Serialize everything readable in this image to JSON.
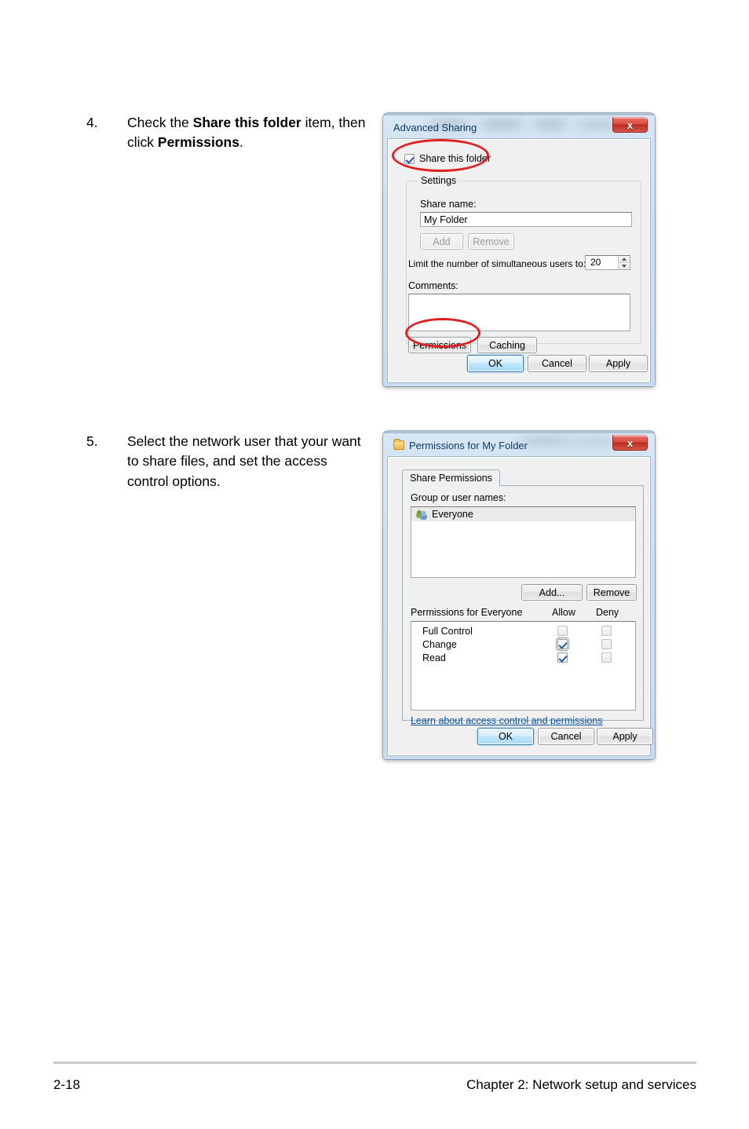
{
  "page": {
    "footer_page_number": "2-18",
    "footer_chapter": "Chapter 2:  Network setup and services"
  },
  "steps": [
    {
      "number": "4.",
      "line1_pre": "Check the ",
      "line1_bold": "Share this folder",
      "line1_post": " item,",
      "line2_pre": "then click ",
      "line2_bold": "Permissions",
      "line2_post": "."
    },
    {
      "number": "5.",
      "text": "Select the network user that your want to share files, and set the access control options."
    }
  ],
  "dialog_advanced_sharing": {
    "title": "Advanced Sharing",
    "close_label": "x",
    "share_this_folder": {
      "label": "Share this folder",
      "checked": true
    },
    "settings_group_label": "Settings",
    "share_name_label": "Share name:",
    "share_name_value": "My Folder",
    "add_button": "Add",
    "remove_button": "Remove",
    "limit_label": "Limit the number of simultaneous users to:",
    "limit_value": "20",
    "comments_label": "Comments:",
    "comments_value": "",
    "permissions_button": "Permissions",
    "caching_button": "Caching",
    "ok_button": "OK",
    "cancel_button": "Cancel",
    "apply_button": "Apply"
  },
  "dialog_permissions": {
    "title": "Permissions for My Folder",
    "close_label": "x",
    "tab_label": "Share Permissions",
    "group_or_user_names_label": "Group or user names:",
    "users": [
      {
        "name": "Everyone",
        "selected": true
      }
    ],
    "add_button": "Add...",
    "remove_button": "Remove",
    "permissions_for_label": "Permissions for Everyone",
    "col_allow": "Allow",
    "col_deny": "Deny",
    "permission_rows": [
      {
        "name": "Full Control",
        "allow": false,
        "deny": false,
        "focused": false
      },
      {
        "name": "Change",
        "allow": true,
        "deny": false,
        "focused": true
      },
      {
        "name": "Read",
        "allow": true,
        "deny": false,
        "focused": false
      }
    ],
    "learn_link": "Learn about access control and permissions",
    "ok_button": "OK",
    "cancel_button": "Cancel",
    "apply_button": "Apply"
  },
  "annotations": {
    "accent_color": "#e02020",
    "highlighted": [
      "share-this-folder-checkbox",
      "permissions-button"
    ]
  }
}
